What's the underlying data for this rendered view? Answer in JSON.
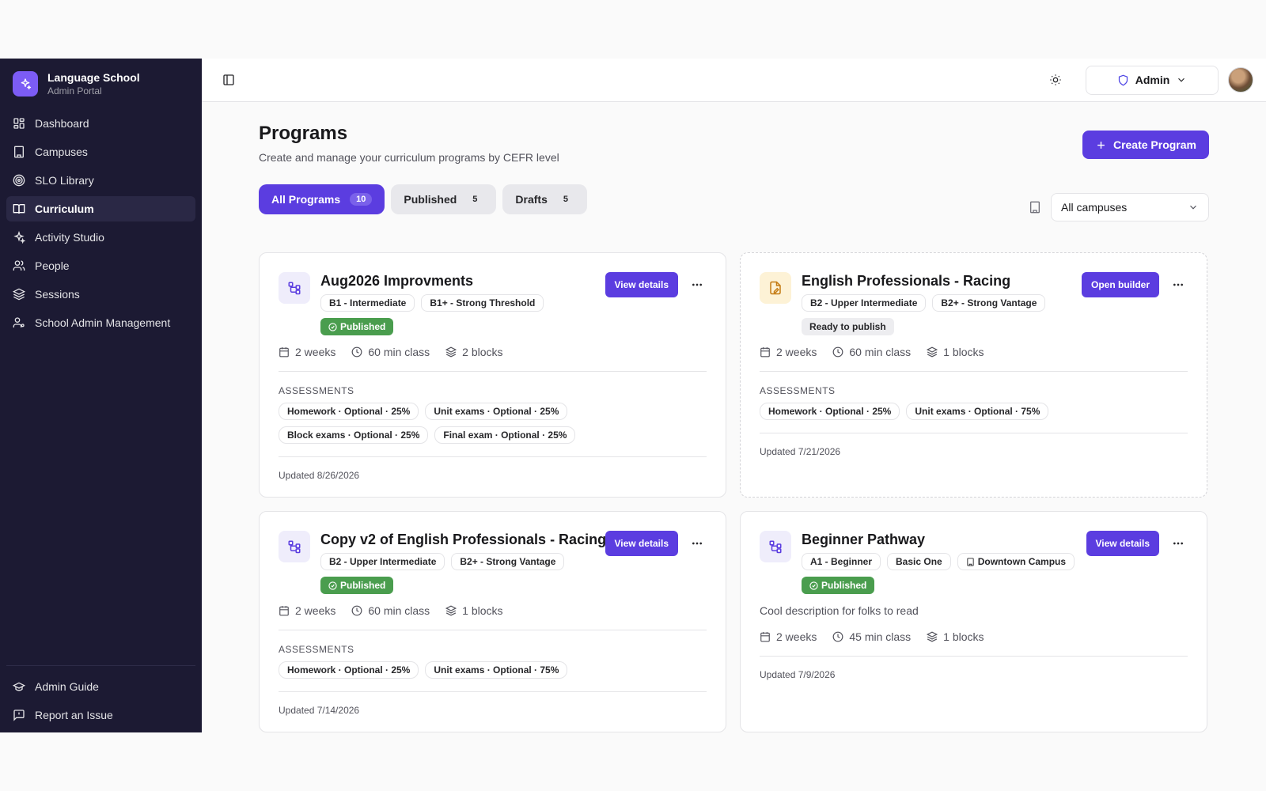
{
  "brand": {
    "name": "Language School",
    "subtitle": "Admin Portal"
  },
  "nav": {
    "items": [
      {
        "label": "Dashboard",
        "icon": "grid-icon"
      },
      {
        "label": "Campuses",
        "icon": "building-icon"
      },
      {
        "label": "SLO Library",
        "icon": "target-icon"
      },
      {
        "label": "Curriculum",
        "icon": "book-icon",
        "active": true
      },
      {
        "label": "Activity Studio",
        "icon": "sparkles-icon"
      },
      {
        "label": "People",
        "icon": "users-icon"
      },
      {
        "label": "Sessions",
        "icon": "layers-icon"
      },
      {
        "label": "School Admin Management",
        "icon": "user-cog-icon"
      }
    ],
    "bottom": [
      {
        "label": "Admin Guide",
        "icon": "graduation-cap-icon"
      },
      {
        "label": "Report an Issue",
        "icon": "message-alert-icon"
      }
    ]
  },
  "topbar": {
    "role_label": "Admin"
  },
  "page": {
    "title": "Programs",
    "subtitle": "Create and manage your curriculum programs by CEFR level",
    "create_label": "Create Program"
  },
  "filters": {
    "tabs": [
      {
        "label": "All Programs",
        "count": "10",
        "active": true
      },
      {
        "label": "Published",
        "count": "5"
      },
      {
        "label": "Drafts",
        "count": "5"
      }
    ],
    "campus_value": "All campuses"
  },
  "programs": [
    {
      "title": "Aug2026 Improvments",
      "tags": [
        "B1 - Intermediate",
        "B1+ - Strong Threshold"
      ],
      "status": "Published",
      "action": "View details",
      "duration": "2 weeks",
      "class_length": "60 min class",
      "blocks": "2 blocks",
      "assessments_label": "ASSESSMENTS",
      "assessments": [
        "Homework · Optional · 25%",
        "Unit exams · Optional · 25%",
        "Block exams · Optional · 25%",
        "Final exam · Optional · 25%"
      ],
      "updated": "Updated 8/26/2026"
    },
    {
      "title": "English Professionals - Racing",
      "tags": [
        "B2 - Upper Intermediate",
        "B2+ - Strong Vantage"
      ],
      "status": "Ready to publish",
      "action": "Open builder",
      "duration": "2 weeks",
      "class_length": "60 min class",
      "blocks": "1 blocks",
      "assessments_label": "ASSESSMENTS",
      "assessments": [
        "Homework · Optional · 25%",
        "Unit exams · Optional · 75%"
      ],
      "updated": "Updated 7/21/2026"
    },
    {
      "title": "Copy v2 of English Professionals - Racing",
      "tags": [
        "B2 - Upper Intermediate",
        "B2+ - Strong Vantage"
      ],
      "status": "Published",
      "action": "View details",
      "duration": "2 weeks",
      "class_length": "60 min class",
      "blocks": "1 blocks",
      "assessments_label": "ASSESSMENTS",
      "assessments": [
        "Homework · Optional · 25%",
        "Unit exams · Optional · 75%"
      ],
      "updated": "Updated 7/14/2026"
    },
    {
      "title": "Beginner Pathway",
      "tags": [
        "A1 - Beginner",
        "Basic One",
        "Downtown Campus"
      ],
      "status": "Published",
      "action": "View details",
      "description": "Cool description for folks to read",
      "duration": "2 weeks",
      "class_length": "45 min class",
      "blocks": "1 blocks",
      "updated": "Updated 7/9/2026"
    }
  ]
}
